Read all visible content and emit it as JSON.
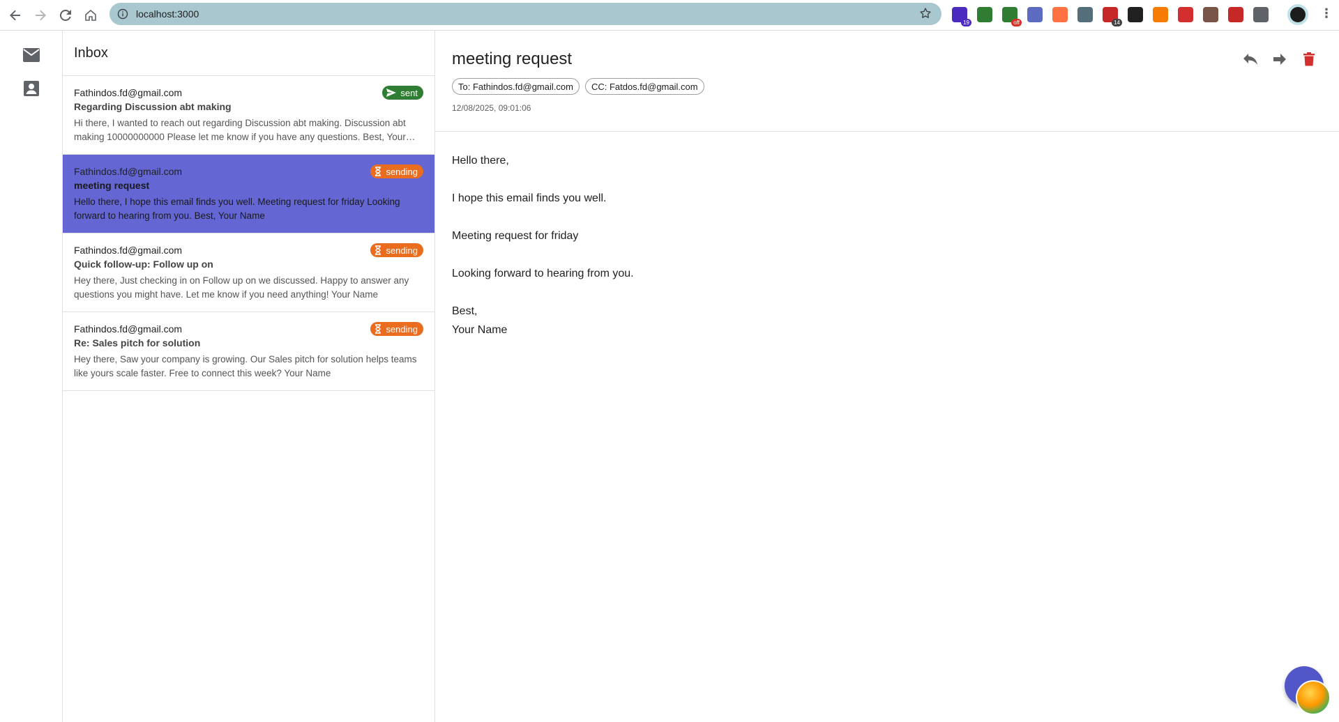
{
  "browser": {
    "url": "localhost:3000",
    "extensions": [
      {
        "name": "graduation-cap-icon",
        "color": "#4b2bbf",
        "badge": "19",
        "badge_color": "#4b2bbf"
      },
      {
        "name": "shield-icon",
        "color": "#2e7d32",
        "badge": "",
        "badge_color": ""
      },
      {
        "name": "cart-icon",
        "color": "#2e7d32",
        "badge": "off",
        "badge_color": "#d93025"
      },
      {
        "name": "translate-icon",
        "color": "#5c6bc0",
        "badge": "",
        "badge_color": ""
      },
      {
        "name": "screenshot-icon",
        "color": "#ff7043",
        "badge": "",
        "badge_color": ""
      },
      {
        "name": "at-sign-icon",
        "color": "#546e7a",
        "badge": "",
        "badge_color": ""
      },
      {
        "name": "calendar-icon",
        "color": "#c62828",
        "badge": "14",
        "badge_color": "#424242"
      },
      {
        "name": "signature-icon",
        "color": "#212121",
        "badge": "",
        "badge_color": ""
      },
      {
        "name": "fox-icon",
        "color": "#f57c00",
        "badge": "",
        "badge_color": ""
      },
      {
        "name": "red-square-icon",
        "color": "#d32f2f",
        "badge": "",
        "badge_color": ""
      },
      {
        "name": "cookie-icon",
        "color": "#795548",
        "badge": "",
        "badge_color": ""
      },
      {
        "name": "mail-check-icon",
        "color": "#c62828",
        "badge": "",
        "badge_color": ""
      },
      {
        "name": "puzzle-icon",
        "color": "#5f6368",
        "badge": "",
        "badge_color": ""
      }
    ]
  },
  "rail": {
    "items": [
      {
        "name": "mail-icon"
      },
      {
        "name": "contact-icon"
      }
    ]
  },
  "list": {
    "title": "Inbox",
    "items": [
      {
        "from": "Fathindos.fd@gmail.com",
        "subject": "Regarding Discussion abt making",
        "preview": "Hi there, I wanted to reach out regarding Discussion abt making. Discussion abt making 10000000000 Please let me know if you have any questions. Best, Your Name",
        "status": "sent",
        "selected": false
      },
      {
        "from": "Fathindos.fd@gmail.com",
        "subject": "meeting request",
        "preview": "Hello there, I hope this email finds you well. Meeting request for friday Looking forward to hearing from you. Best, Your Name",
        "status": "sending",
        "selected": true
      },
      {
        "from": "Fathindos.fd@gmail.com",
        "subject": "Quick follow-up: Follow up on",
        "preview": "Hey there, Just checking in on Follow up on we discussed. Happy to answer any questions you might have. Let me know if you need anything! Your Name",
        "status": "sending",
        "selected": false
      },
      {
        "from": "Fathindos.fd@gmail.com",
        "subject": "Re: Sales pitch for solution",
        "preview": "Hey there, Saw your company is growing. Our Sales pitch for solution helps teams like yours scale faster. Free to connect this week? Your Name",
        "status": "sending",
        "selected": false
      }
    ]
  },
  "detail": {
    "subject": "meeting request",
    "to": "To: Fathindos.fd@gmail.com",
    "cc": "CC: Fatdos.fd@gmail.com",
    "timestamp": "12/08/2025, 09:01:06",
    "body": {
      "greeting": "Hello there,",
      "line1": "I hope this email finds you well.",
      "line2": "Meeting request for friday",
      "line3": "Looking forward to hearing from you.",
      "signoff": "Best,",
      "signature": "Your Name"
    }
  },
  "colors": {
    "selected_row": "#6466d4",
    "sent_chip": "#2e7d32",
    "sending_chip": "#e96c1f",
    "delete_icon": "#d32f2f",
    "fab": "#5157c8"
  }
}
